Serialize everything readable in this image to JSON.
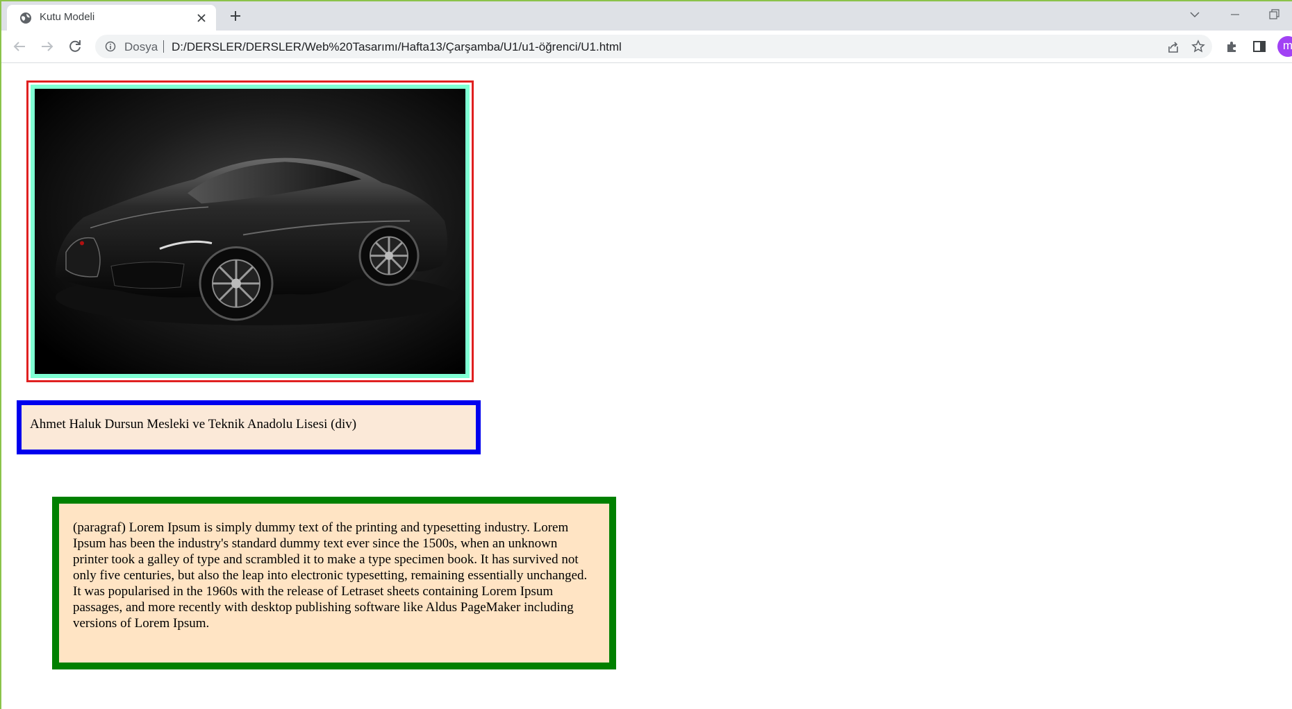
{
  "browser": {
    "tab_title": "Kutu Modeli",
    "address_scheme": "Dosya",
    "address_url": "D:/DERSLER/DERSLER/Web%20Tasarımı/Hafta13/Çarşamba/U1/u1-öğrenci/U1.html",
    "avatar_letter": "m"
  },
  "page": {
    "image_alt": "Black sports car",
    "div_text": "Ahmet Haluk Dursun Mesleki ve Teknik Anadolu Lisesi (div)",
    "paragraph_text": "(paragraf) Lorem Ipsum is simply dummy text of the printing and typesetting industry. Lorem Ipsum has been the industry's standard dummy text ever since the 1500s, when an unknown printer took a galley of type and scrambled it to make a type specimen book. It has survived not only five centuries, but also the leap into electronic typesetting, remaining essentially unchanged. It was popularised in the 1960s with the release of Letraset sheets containing Lorem Ipsum passages, and more recently with desktop publishing software like Aldus PageMaker including versions of Lorem Ipsum."
  },
  "colors": {
    "image_outer_border": "#e02020",
    "image_inner_border": "#7fffd4",
    "div_border": "#0000ee",
    "div_background": "#fbe9d8",
    "paragraph_border": "#008000",
    "paragraph_background": "#ffe4c4",
    "window_accent": "#8bc34a"
  }
}
